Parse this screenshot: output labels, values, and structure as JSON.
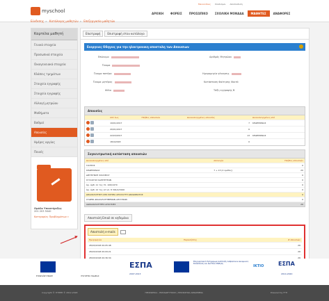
{
  "header": {
    "logo": "myschool",
    "toplinks": [
      "Μενού ίδιας",
      "Σύνδεσμοι",
      "Αποσύνδεση"
    ],
    "nav": [
      "ΑΡΧΙΚΗ",
      "ΦΟΡΕΙΣ",
      "ΠΡΟΣΩΠΙΚΟ",
      "ΣΧΟΛΙΚΗ ΜΟΝΑΔΑ",
      "ΜΑΘΗΤΕΣ",
      "ΑΝΑΦΟΡΕΣ"
    ]
  },
  "breadcrumbs": [
    "Εύνδεσης",
    "Κατάλογος μαθητών",
    "Επεξεργασία μαθητών"
  ],
  "sidebar": {
    "title": "Καρτέλα μαθητή",
    "items": [
      "Γενικά στοιχεία",
      "Προσωπικά στοιχεία",
      "Οικογενειακά στοιχεία",
      "Κλάσεις τμημάτων",
      "Στοιχεία εγγραφής",
      "Στοιχεία εγγραφής",
      "Αλλαγή μητρώου",
      "Μαθήματα",
      "Βαθμοί",
      "Απουσίες",
      "Ημέρες αργίας",
      "Ποινές"
    ],
    "active_index": 9,
    "phone_label": "Ομάδα Υποστήριξης",
    "phone": "201 203 5040",
    "contact_link": "Κατηγορίες Προβλημάτων »"
  },
  "tabs": [
    "Επιστροφή",
    "Επιστροφή στον κατάλογο"
  ],
  "banner": "Ενεργειες Οδηγιες για την ηλεκτρονικη αποστολη των Απουσιων",
  "student_fields": {
    "left": [
      "Επώνυμο",
      "Όνομα",
      "Όνομα πατέρα",
      "Όνομα μητέρας",
      "Φύλο"
    ],
    "right": [
      "Αριθμός Μητρώου",
      "Ημερομηνία γέννησης",
      "Κατάσταση Φοίτησης",
      "Τάξη εγγραφής"
    ],
    "right_values": [
      "",
      "",
      "Φοιτά",
      "Β"
    ]
  },
  "absences": {
    "title": "Απουσίες",
    "headers": [
      "",
      "Από έως",
      "Πλήθος απουσιών",
      "Δικαιολογημένες απουσίες",
      "Δικαιολογημένες από"
    ],
    "rows": [
      [
        "",
        "19/01/2017",
        "",
        "7",
        "ΚΗΔΕΜΟΝΑΣ"
      ],
      [
        "",
        "20/01/2017",
        "",
        "6",
        ""
      ],
      [
        "",
        "22/03/2017",
        "",
        "13",
        "ΚΗΔΕΜΟΝΑΣ"
      ],
      [
        "",
        "18/4/2018",
        "",
        "0",
        ""
      ]
    ]
  },
  "summary": {
    "title": "Συγκεντρωτική κατάσταση απουσιών",
    "headers": [
      "Δικαιολογημένες από",
      "Απολογία",
      "Πλήθος απουσιών"
    ],
    "rows": [
      [
        "ΓΙΑΤΡΟΣ",
        "",
        "0"
      ],
      [
        "ΚΗΔΕΜΟΝΑΣ",
        "7 + 13 (2 ομάδες)",
        "20"
      ],
      [
        "ΔΙΕΥΘΥΝΣΗ ΣΧΟΛΕΙΟΥ",
        "",
        "0"
      ],
      [
        "ΣΥΛΛΟΓΟΣ ΚΑΘΗΓΗΤΩΝ",
        "",
        "0"
      ],
      [
        "Άρ. άρθ. 11 της Υπ. 106/1979",
        "",
        "0"
      ],
      [
        "Άρ. άρθ. 12 της ΑΥ υπ. 8 304/2/1990",
        "",
        "0"
      ],
      [
        "ΔΙΚΑΙΟΛΟΓΗΣΗ ΑΠΟ ΣΧΗΜΑ ΑΠΟΛΛΥΤΗ ΔΙΚΑΙΩΜΑΤΟΣ",
        "",
        "0"
      ],
      [
        "ΟΥΔΕΝΙ ΔΙΚΑΙΟΛΟΓΗΜΕΝΩΝ ΑΠΟΥΣΙΩΝ",
        "",
        "0"
      ],
      [
        "ΑΔΙΚΑΙΟΛΟΓΗΤΕΣ ΑΠΟΥΣΙΕΣ",
        "",
        "26"
      ]
    ]
  },
  "email_button": "Αποστολή Email σε κηδεμόνα",
  "history": {
    "title": "Αποστολή e-mails",
    "headers": [
      "Ημερομηνία",
      "Παραλήπτης",
      "# Απουσιών"
    ],
    "rows": [
      [
        "28/03/2018 09:05:48",
        "",
        "26"
      ],
      [
        "28/03/2018 09:09:21",
        "",
        "26"
      ],
      [
        "28/03/2018 09:36:34",
        "",
        "26"
      ]
    ]
  },
  "funding": {
    "eu_text": "ΕΥΡΩΠΑΪΚΗ ΕΝΩΣΗ",
    "ministry": "ΥΠΟΥΡΓΕΙΟ ΠΑΙΔΕΙΑΣ",
    "espa": "ΕΣΠΑ",
    "espa_years_1": "2007-2013",
    "espa_years_2": "2014-2020",
    "program": "Επιχειρησιακό Πρόγραμμα Ανάπτυξη Ανθρώπινου Δυναμικού, Εκπαίδευση και Διά Βίου Μάθηση",
    "iktio": "ΙΚΤΙΟ"
  },
  "footer": {
    "copyright": "Copyright © ΥΠΠΕΘ © 2012-2018",
    "links": "ΠΡΟΣΩΠΙΚΑ - ΕΚΠΑΙΔΕΥΤΙΚΟΣ | ΠΡΟΣΩΠΙΚΑ ΔΕΔΟΜΕΝΑ",
    "version": "Powered by ΓΤΠ"
  }
}
